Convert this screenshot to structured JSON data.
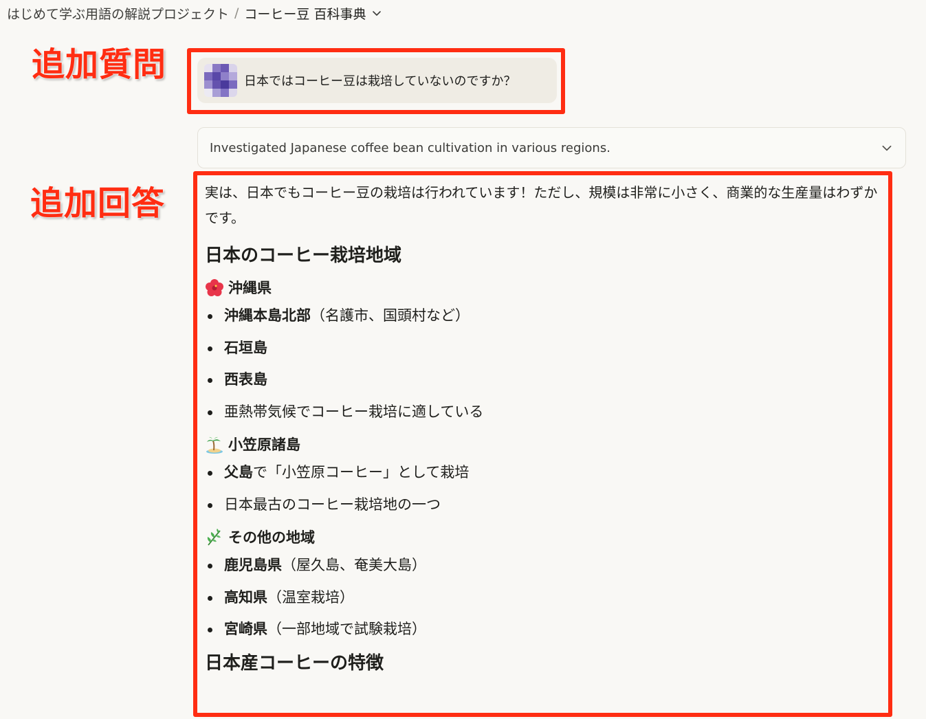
{
  "breadcrumb": {
    "project": "はじめて学ぶ用語の解説プロジェクト",
    "separator": "/",
    "current": "コーヒー豆 百科事典"
  },
  "annotations": {
    "question_label": "追加質問",
    "answer_label": "追加回答",
    "color": "#ff2d12"
  },
  "user_message": {
    "text": "日本ではコーヒー豆は栽培していないのですか？"
  },
  "tool_summary": {
    "text": "Investigated Japanese coffee bean cultivation in various regions."
  },
  "answer": {
    "intro": "実は、日本でもコーヒー豆の栽培は行われています！ただし、規模は非常に小さく、商業的な生産量はわずかです。",
    "heading": "日本のコーヒー栽培地域",
    "sections": [
      {
        "emoji": "hibiscus-icon",
        "title": "沖縄県",
        "items": [
          {
            "bold": "沖縄本島北部",
            "rest": "（名護市、国頭村など）"
          },
          {
            "bold": "石垣島",
            "rest": ""
          },
          {
            "bold": "西表島",
            "rest": ""
          },
          {
            "bold": "",
            "rest": "亜熱帯気候でコーヒー栽培に適している"
          }
        ]
      },
      {
        "emoji": "island-icon",
        "title": "小笠原諸島",
        "items": [
          {
            "bold": "父島",
            "rest": "で「小笠原コーヒー」として栽培"
          },
          {
            "bold": "",
            "rest": "日本最古のコーヒー栽培地の一つ"
          }
        ]
      },
      {
        "emoji": "herb-icon",
        "title": "その他の地域",
        "items": [
          {
            "bold": "鹿児島県",
            "rest": "（屋久島、奄美大島）"
          },
          {
            "bold": "高知県",
            "rest": "（温室栽培）"
          },
          {
            "bold": "宮崎県",
            "rest": "（一部地域で試験栽培）"
          }
        ]
      }
    ],
    "next_heading": "日本産コーヒーの特徴"
  }
}
